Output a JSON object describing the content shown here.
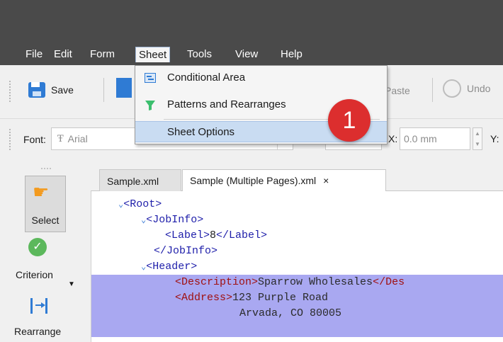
{
  "menubar": {
    "items": [
      {
        "label": "File"
      },
      {
        "label": "Edit"
      },
      {
        "label": "Form"
      },
      {
        "label": "Sheet"
      },
      {
        "label": "Tools"
      },
      {
        "label": "View"
      },
      {
        "label": "Help"
      }
    ]
  },
  "sheet_menu": {
    "items": [
      {
        "label": "Conditional Area",
        "icon": "conditional-area-icon"
      },
      {
        "label": "Patterns and Rearranges",
        "icon": "filter-funnel-icon"
      },
      {
        "label": "Sheet Options"
      }
    ]
  },
  "toolbar": {
    "save_label": "Save",
    "paste_label": "Paste",
    "undo_label": "Undo"
  },
  "format_bar": {
    "font_label": "Font:",
    "font_value": "Arial",
    "x_label": "X:",
    "x_value": "0.0 mm",
    "y_label": "Y:"
  },
  "tools": {
    "select_label": "Select",
    "criterion_label": "Criterion",
    "rearrange_label": "Rearrange"
  },
  "tabs": [
    {
      "label": "Sample.xml"
    },
    {
      "label": "Sample (Multiple Pages).xml",
      "close": "×"
    }
  ],
  "editor": {
    "lines": [
      {
        "open": "<Root>"
      },
      {
        "open": "<JobInfo>"
      },
      {
        "open": "<Label>",
        "text": "8",
        "close": "</Label>"
      },
      {
        "open": "</JobInfo>"
      },
      {
        "open": "<Header>"
      },
      {
        "open": "<Description>",
        "text": "Sparrow Wholesales",
        "close": "</Des"
      },
      {
        "open": "<Address>",
        "text": "123 Purple Road"
      },
      {
        "text": "Arvada, CO 80005"
      }
    ]
  },
  "annotation": {
    "step": "1"
  },
  "colors": {
    "menubar_bg": "#4a4a4a",
    "selection_bg": "#a9a8f1",
    "badge": "#dc2e2e",
    "menu_highlight": "#c9dcf2"
  }
}
